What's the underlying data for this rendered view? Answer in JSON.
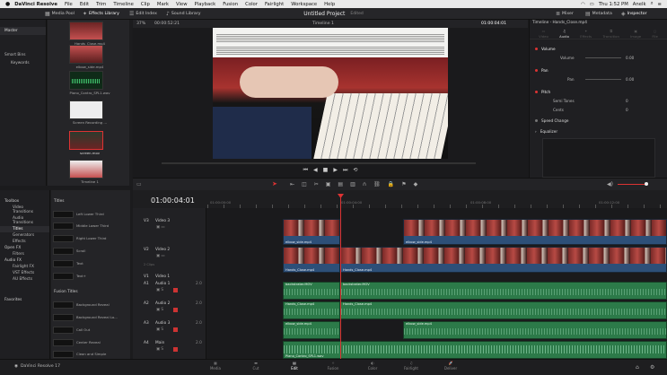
{
  "menubar": {
    "apple": "",
    "app": "DaVinci Resolve",
    "items": [
      "File",
      "Edit",
      "Trim",
      "Timeline",
      "Clip",
      "Mark",
      "View",
      "Playback",
      "Fusion",
      "Color",
      "Fairlight",
      "Workspace",
      "Help"
    ],
    "clock": "Thu 1:52 PM",
    "user": "Anelk"
  },
  "toolbar": {
    "media_pool": "Media Pool",
    "effects_library": "Effects Library",
    "edit_index": "Edit Index",
    "sound_library": "Sound Library",
    "project_title": "Untitled Project",
    "project_status": "Edited",
    "mixer": "Mixer",
    "metadata": "Metadata",
    "inspector": "Inspector"
  },
  "media": {
    "bins": [
      "Master",
      "Smart Bins",
      "Keywords"
    ],
    "clips": [
      "Hands_Close.mp4",
      "elbow_side.mp4",
      "Piano_Contro_SPL1.wav",
      "Screen Recording ...",
      "screen.mov",
      "Timeline 1"
    ]
  },
  "viewer": {
    "zoom": "37%",
    "timecode_left": "00:00:52:21",
    "timeline_name": "Timeline 1",
    "timecode_right": "01:00:04:01"
  },
  "inspector": {
    "title": "Timeline - Hands_Close.mp4",
    "tabs": [
      "Video",
      "Audio",
      "Effects",
      "Transition",
      "Image",
      "File"
    ],
    "sections": {
      "volume": "Volume",
      "volume_label": "Volume",
      "volume_value": "0.00",
      "pan": "Pan",
      "pan_label": "Pan",
      "pan_value": "0.00",
      "pitch": "Pitch",
      "semi_tones": "Semi Tones",
      "semi_value": "0",
      "cents": "Cents",
      "cents_value": "0",
      "speed_change": "Speed Change",
      "equalizer": "Equalizer"
    }
  },
  "effects": {
    "left": [
      "Toolbox",
      "Video Transitions",
      "Audio Transitions",
      "Titles",
      "Generators",
      "Effects",
      "Open FX",
      "Filters",
      "Audio FX",
      "Fairlight FX",
      "VST Effects",
      "AU Effects",
      "Favorites"
    ],
    "titles_header": "Titles",
    "titles": [
      "Left Lower Third",
      "Middle Lower Third",
      "Right Lower Third",
      "Scroll",
      "Text",
      "Text+"
    ],
    "fusion_header": "Fusion Titles",
    "fusion": [
      "Background Reveal",
      "Background Reveal Lo...",
      "Call Out",
      "Center Reveal",
      "Clean and Simple"
    ]
  },
  "timeline": {
    "timecode": "01:00:04:01",
    "ruler": [
      "01:00:00:00",
      "01:00:04:00",
      "01:00:08:00",
      "01:00:12:00"
    ],
    "tracks": [
      {
        "id": "V3",
        "name": "Video 3",
        "clips": "0 Clip"
      },
      {
        "id": "V2",
        "name": "Video 2",
        "clips": "2 Clips"
      },
      {
        "id": "V1",
        "name": "Video 1"
      },
      {
        "id": "A1",
        "name": "Audio 1",
        "level": "2.0"
      },
      {
        "id": "A2",
        "name": "Audio 2",
        "level": "2.0"
      },
      {
        "id": "A3",
        "name": "Audio 3",
        "level": "2.0"
      },
      {
        "id": "A4",
        "name": "Main",
        "level": "2.0"
      }
    ],
    "clip_labels": {
      "elbow": "elbow_side.mp4",
      "hands": "Hands_Close.mp4",
      "backstrater": "backstrater.MOV",
      "piano": "Piano_Contro_SPL1.wav"
    }
  },
  "bottom": {
    "app": "DaVinci Resolve 17",
    "tabs": [
      "Media",
      "Cut",
      "Edit",
      "Fusion",
      "Color",
      "Fairlight",
      "Deliver"
    ]
  }
}
